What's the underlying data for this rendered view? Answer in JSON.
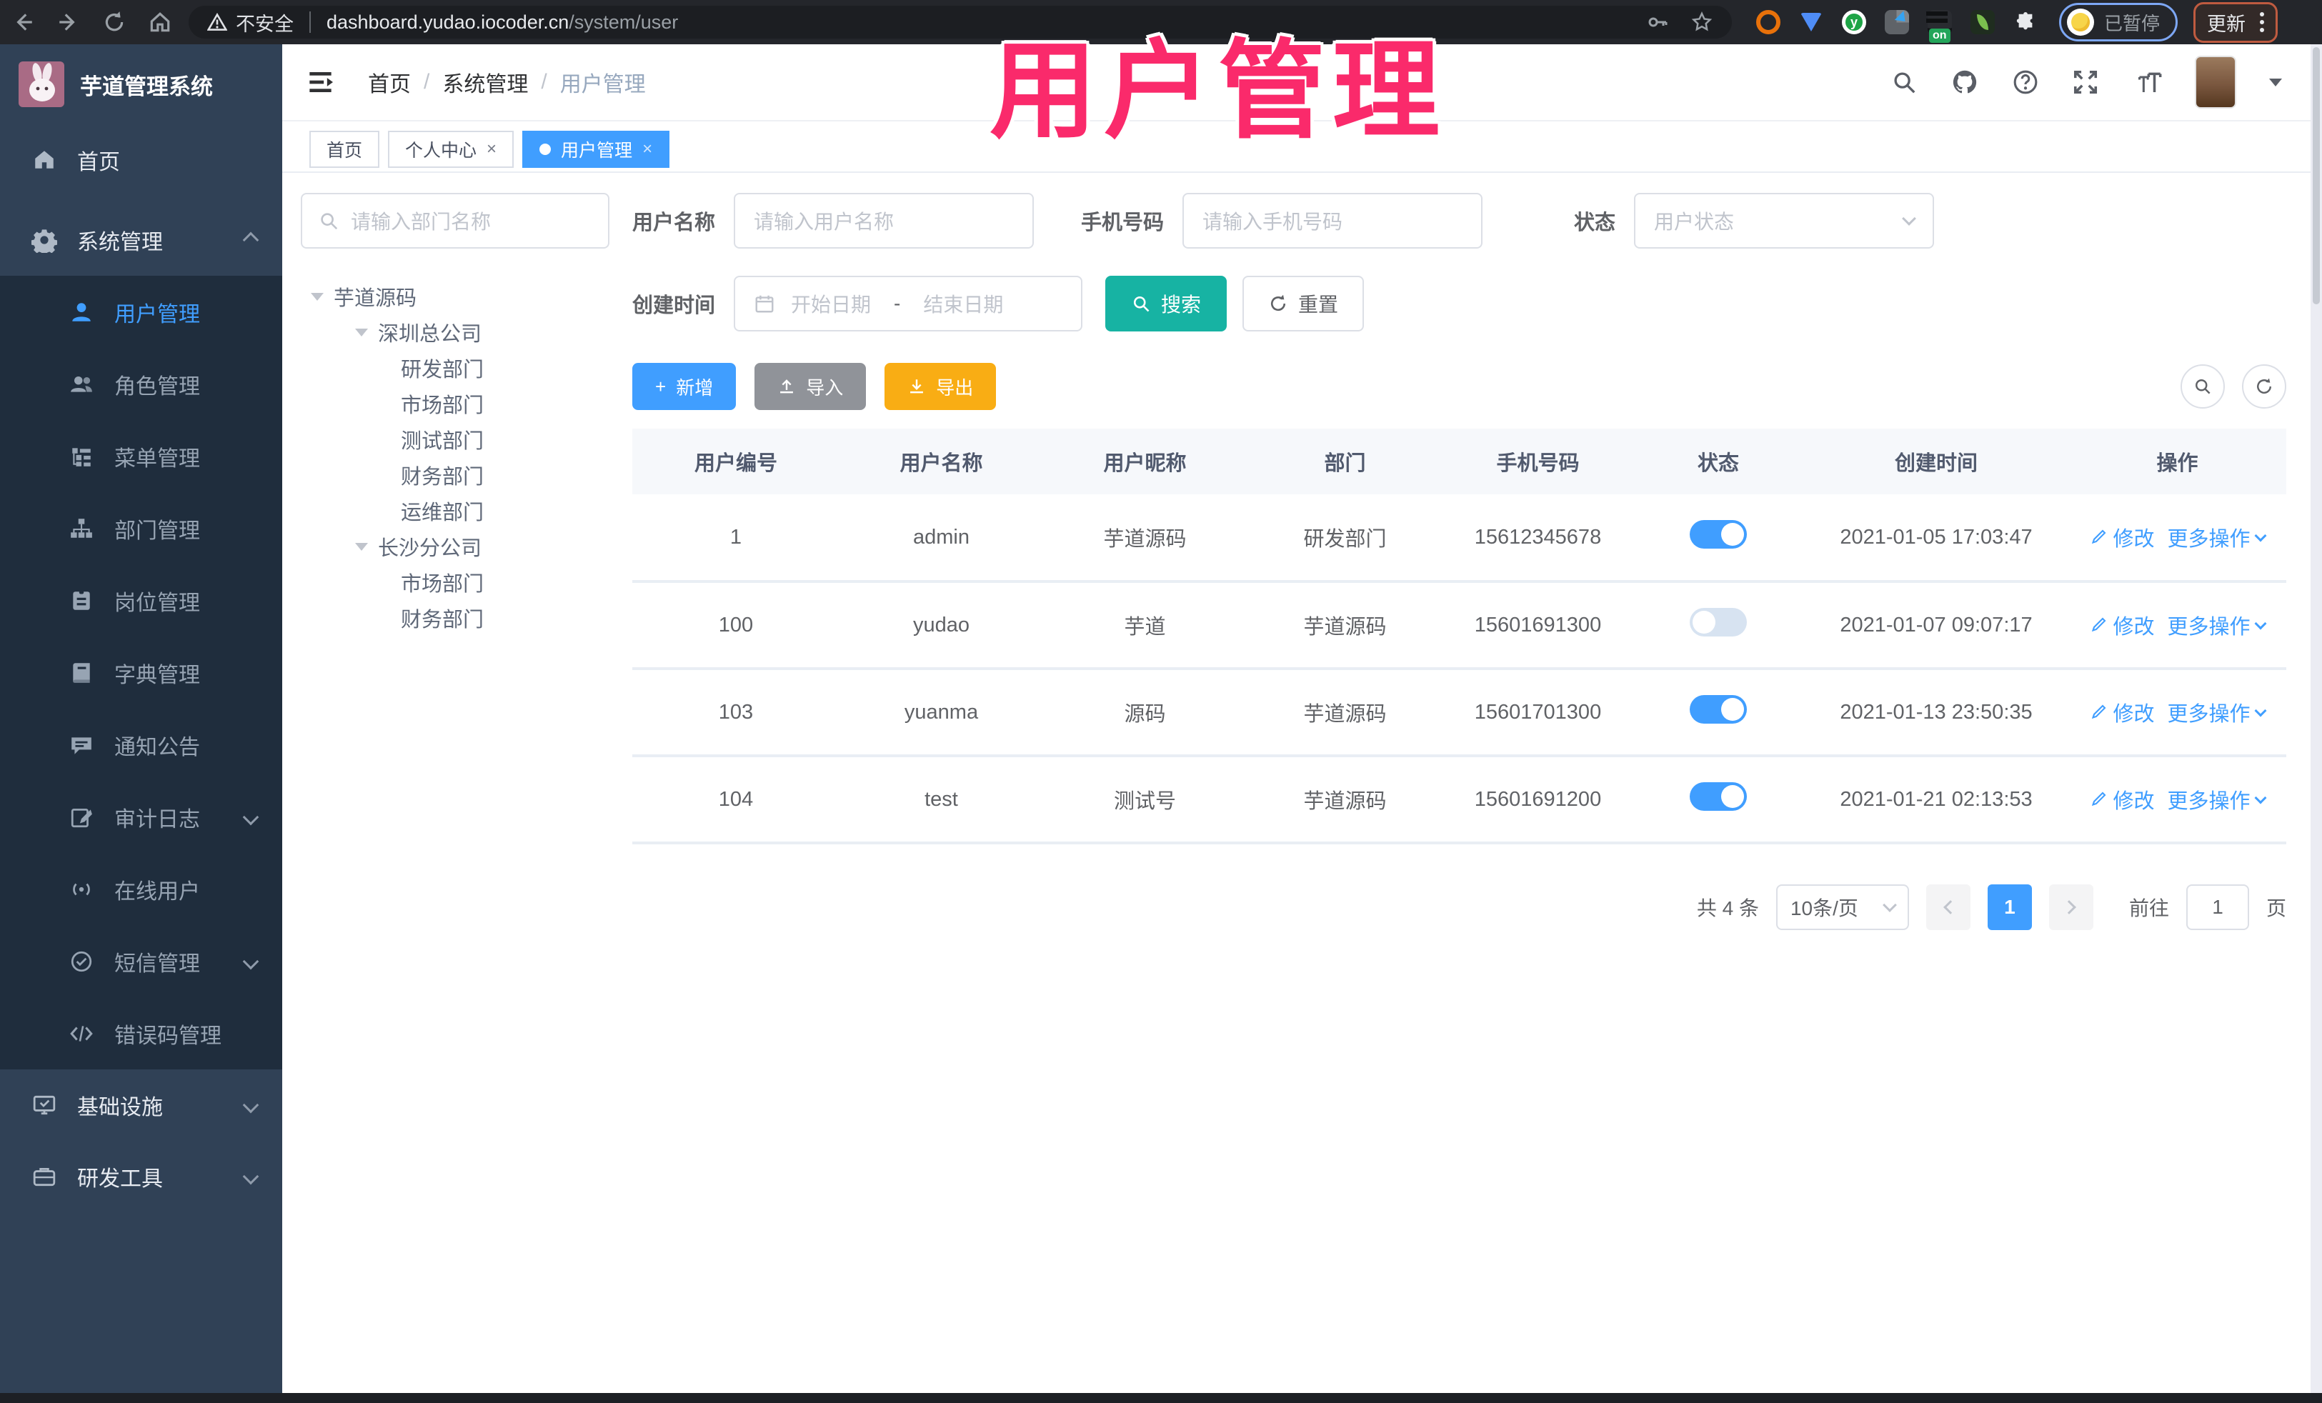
{
  "ui": {
    "close": "×",
    "plus": "+",
    "slash": "/"
  },
  "colors": {
    "primary": "#409eff",
    "search_teal": "#17b3a3",
    "export_amber": "#f9ad14",
    "import_gray": "#909399",
    "watermark_pink": "#fa2a6b",
    "sidebar_bg": "#304156",
    "submenu_bg": "#1f2d3d"
  },
  "browser": {
    "security_label": "不安全",
    "url_host": "dashboard.yudao.iocoder.cn",
    "url_path": "/system/user",
    "extension_on_badge": "on",
    "profile_status": "已暂停",
    "update_label": "更新"
  },
  "watermark": "用户管理",
  "sidebar": {
    "app_title": "芋道管理系统",
    "home": "首页",
    "system": "系统管理",
    "submenu": [
      {
        "label": "用户管理"
      },
      {
        "label": "角色管理"
      },
      {
        "label": "菜单管理"
      },
      {
        "label": "部门管理"
      },
      {
        "label": "岗位管理"
      },
      {
        "label": "字典管理"
      },
      {
        "label": "通知公告"
      },
      {
        "label": "审计日志"
      },
      {
        "label": "在线用户"
      },
      {
        "label": "短信管理"
      },
      {
        "label": "错误码管理"
      }
    ],
    "infra": "基础设施",
    "devtools": "研发工具"
  },
  "header": {
    "breadcrumb": [
      "首页",
      "系统管理",
      "用户管理"
    ]
  },
  "tabs": [
    {
      "label": "首页"
    },
    {
      "label": "个人中心"
    },
    {
      "label": "用户管理"
    }
  ],
  "dept_tree": {
    "search_placeholder": "请输入部门名称",
    "nodes": [
      {
        "label": "芋道源码"
      },
      {
        "label": "深圳总公司"
      },
      {
        "label": "研发部门"
      },
      {
        "label": "市场部门"
      },
      {
        "label": "测试部门"
      },
      {
        "label": "财务部门"
      },
      {
        "label": "运维部门"
      },
      {
        "label": "长沙分公司"
      },
      {
        "label": "市场部门"
      },
      {
        "label": "财务部门"
      }
    ]
  },
  "filters": {
    "username": {
      "label": "用户名称",
      "placeholder": "请输入用户名称"
    },
    "mobile": {
      "label": "手机号码",
      "placeholder": "请输入手机号码"
    },
    "status": {
      "label": "状态",
      "placeholder": "用户状态"
    },
    "create_time": {
      "label": "创建时间",
      "start_placeholder": "开始日期",
      "separator": "-",
      "end_placeholder": "结束日期"
    },
    "search_label": "搜索",
    "reset_label": "重置"
  },
  "toolbar": {
    "add_label": "新增",
    "import_label": "导入",
    "export_label": "导出"
  },
  "table": {
    "columns": [
      "用户编号",
      "用户名称",
      "用户昵称",
      "部门",
      "手机号码",
      "状态",
      "创建时间",
      "操作"
    ],
    "actions": {
      "edit": "修改",
      "more": "更多操作"
    },
    "rows": [
      {
        "id": "1",
        "username": "admin",
        "nickname": "芋道源码",
        "dept": "研发部门",
        "mobile": "15612345678",
        "status_on": true,
        "created": "2021-01-05 17:03:47"
      },
      {
        "id": "100",
        "username": "yudao",
        "nickname": "芋道",
        "dept": "芋道源码",
        "mobile": "15601691300",
        "status_on": false,
        "created": "2021-01-07 09:07:17"
      },
      {
        "id": "103",
        "username": "yuanma",
        "nickname": "源码",
        "dept": "芋道源码",
        "mobile": "15601701300",
        "status_on": true,
        "created": "2021-01-13 23:50:35"
      },
      {
        "id": "104",
        "username": "test",
        "nickname": "测试号",
        "dept": "芋道源码",
        "mobile": "15601691200",
        "status_on": true,
        "created": "2021-01-21 02:13:53"
      }
    ]
  },
  "pagination": {
    "total": "共 4 条",
    "page_size": "10条/页",
    "current_page": "1",
    "goto_label": "前往",
    "goto_value": "1",
    "page_unit": "页"
  }
}
